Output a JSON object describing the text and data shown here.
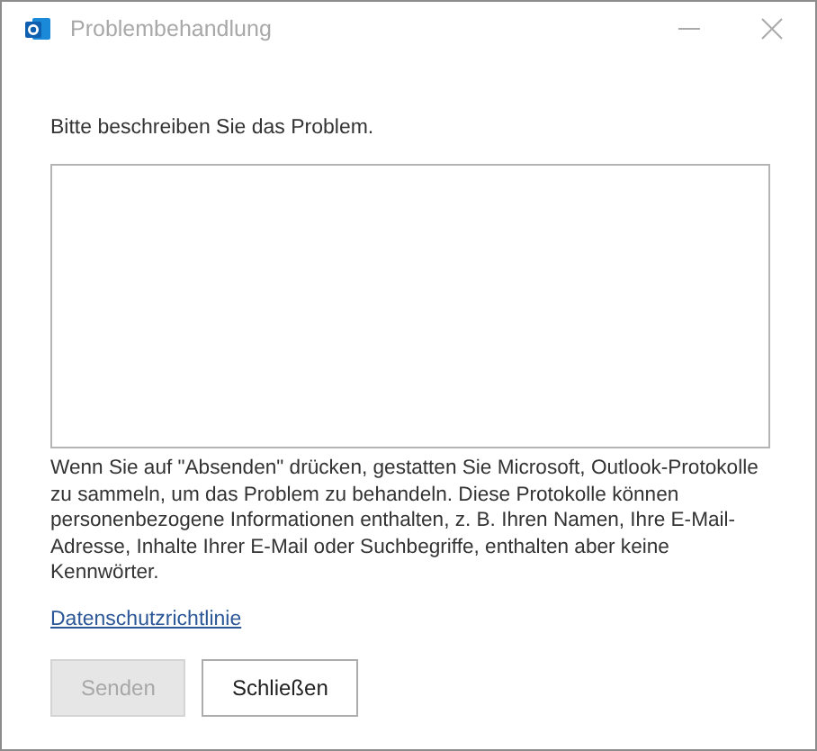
{
  "window": {
    "title": "Problembehandlung"
  },
  "prompt": "Bitte beschreiben Sie das Problem.",
  "notice": "Wenn Sie auf \"Absenden\" drücken, gestatten Sie Microsoft, Outlook-Protokolle zu sammeln, um das Problem zu behandeln. Diese Protokolle können personenbezogene Informationen enthalten, z. B. Ihren Namen, Ihre E-Mail-Adresse, Inhalte Ihrer E-Mail oder Suchbegriffe, enthalten aber keine Kennwörter.",
  "privacy_link": "Datenschutzrichtlinie",
  "buttons": [
    {
      "label": "Senden",
      "disabled": true
    },
    {
      "label": "Schließen",
      "disabled": false
    }
  ]
}
